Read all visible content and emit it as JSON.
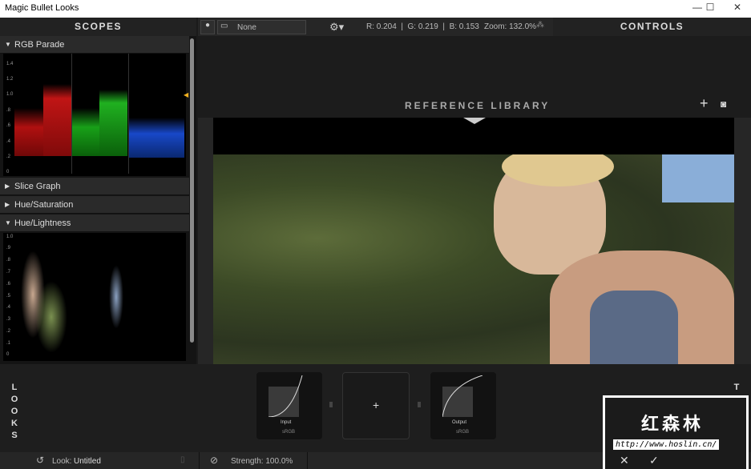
{
  "window": {
    "title": "Magic Bullet Looks",
    "minimize": "—",
    "maximize": "☐",
    "close": "✕"
  },
  "headers": {
    "scopes": "SCOPES",
    "controls": "CONTROLS"
  },
  "toolbar": {
    "preset": "None",
    "rgb": "R: 0.204  |  G: 0.219  |  B: 0.153",
    "zoom": "Zoom: 132.0%"
  },
  "scopes": {
    "sections": [
      "RGB Parade",
      "Slice Graph",
      "Hue/Saturation",
      "Hue/Lightness"
    ],
    "parade_ticks": [
      "1.4",
      "1.2",
      "1.0",
      ".8",
      ".6",
      ".4",
      ".2",
      "0"
    ],
    "hl_ticks": [
      "1.0",
      ".9",
      ".8",
      ".7",
      ".6",
      ".5",
      ".4",
      ".3",
      ".2",
      ".1",
      "0"
    ]
  },
  "reference_library": {
    "title": "REFERENCE LIBRARY",
    "add": "+",
    "camera": "📷"
  },
  "tools": {
    "looks_label": "LOOKS",
    "tools_label": "TOOLS",
    "add": "+",
    "input": {
      "label": "Input",
      "space": "sRGB"
    },
    "output": {
      "label": "Output",
      "space": "sRGB"
    }
  },
  "status": {
    "look_label": "Look:",
    "look_value": "Untitled",
    "strength": "Strength: 100.0%"
  },
  "watermark": {
    "text": "红森林",
    "url": "http://www.hoslin.cn/",
    "cancel": "✕",
    "ok": "✓"
  },
  "colors": {
    "accent": "#f0b020"
  }
}
